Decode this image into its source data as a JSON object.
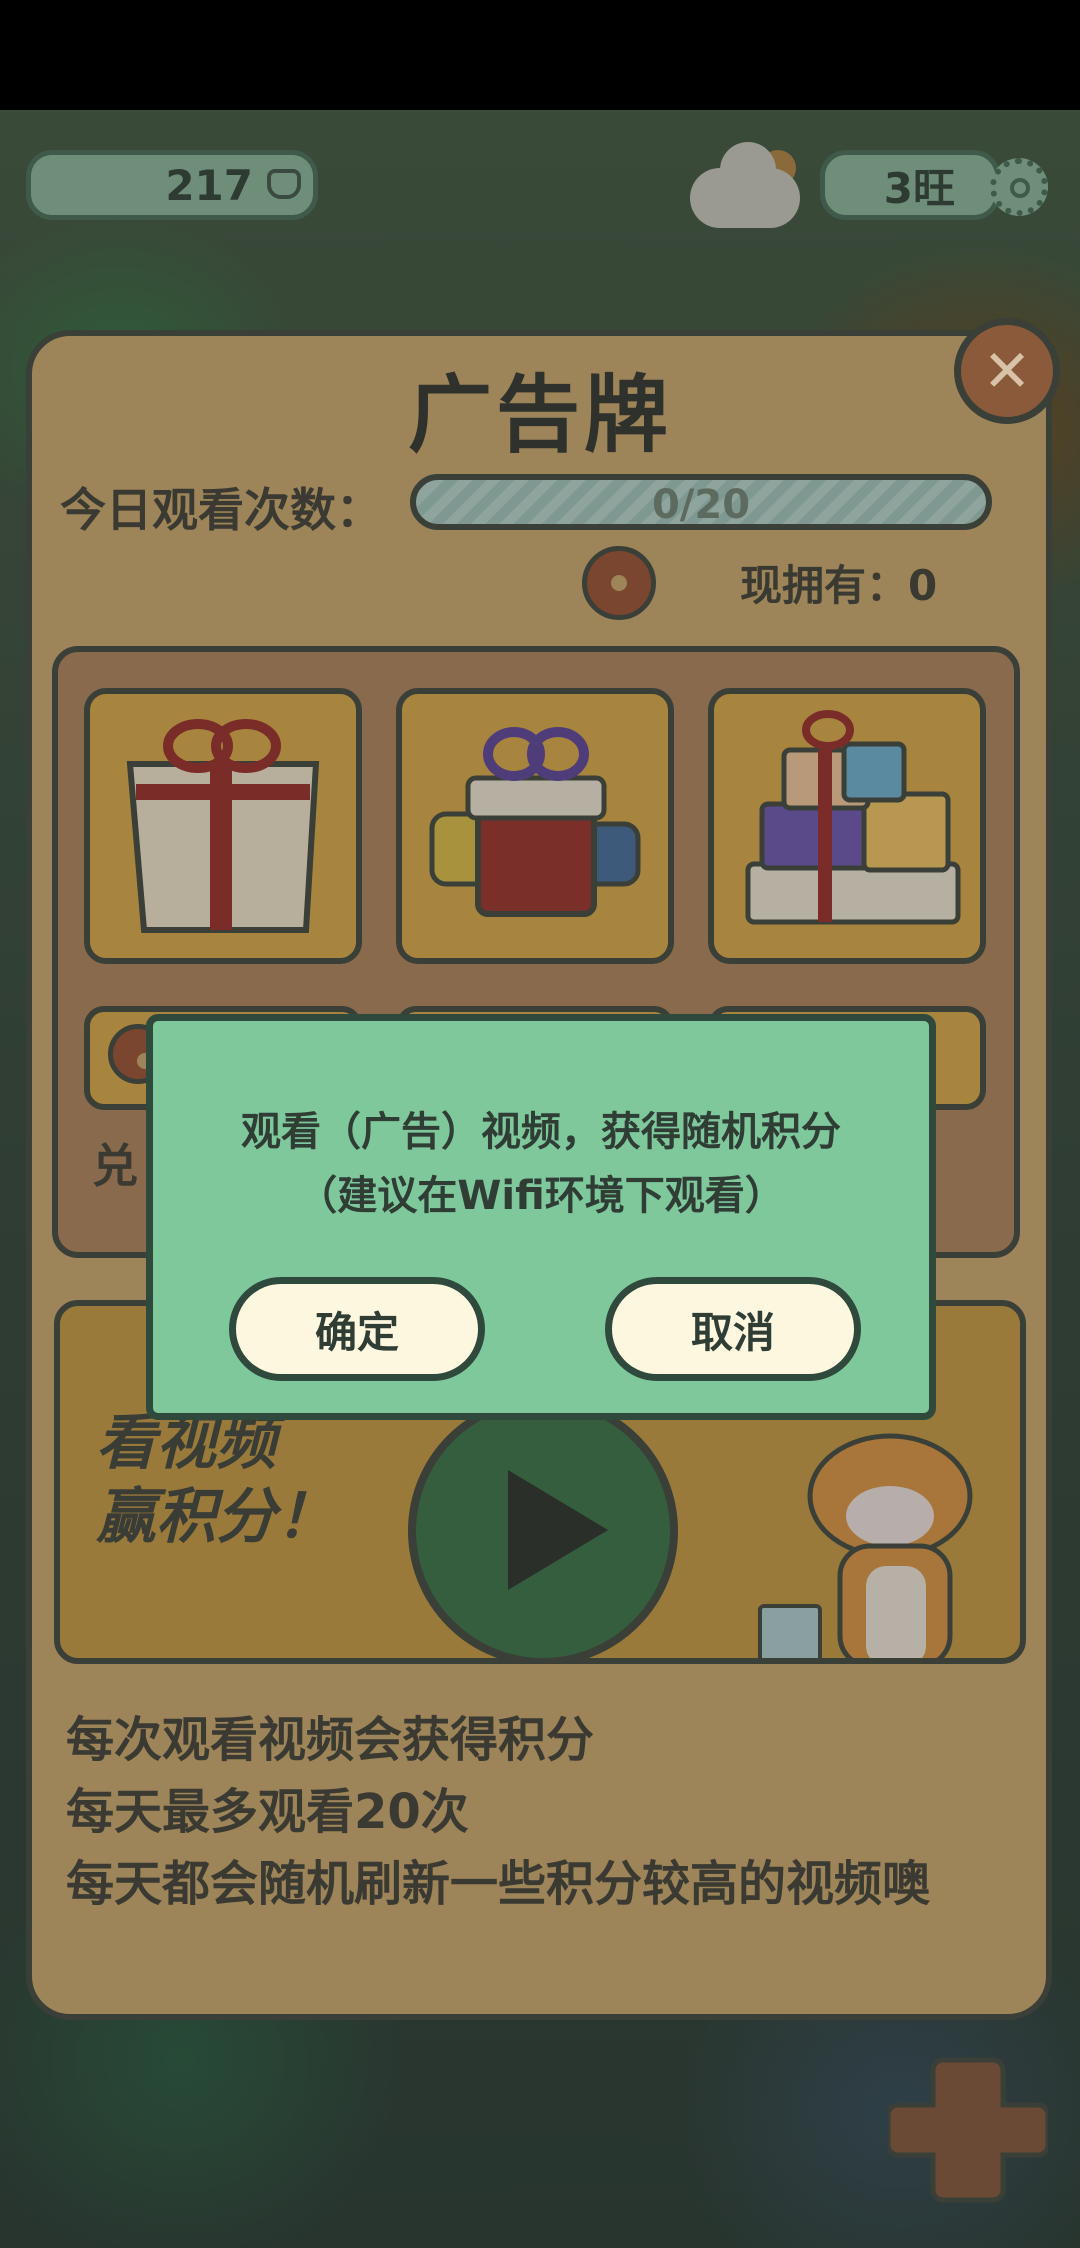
{
  "hud": {
    "score": "217",
    "wang": "3旺"
  },
  "panel": {
    "title": "广告牌",
    "watch_label": "今日观看次数：",
    "progress": {
      "text": "0/20",
      "fraction": 0
    },
    "owned": "现拥有：0",
    "redeem_label": "兑",
    "video_banner": {
      "line1": "看视频",
      "line2": "赢积分！"
    },
    "descriptions": [
      "每次观看视频会获得积分",
      "每天最多观看20次",
      "每天都会随机刷新一些积分较高的视频噢"
    ]
  },
  "dialog": {
    "message": "观看（广告）视频，获得随机积分",
    "note": "（建议在Wifi环境下观看）",
    "confirm": "确定",
    "cancel": "取消"
  },
  "colors": {
    "panel": "#9e8459",
    "dialog": "#7ec89c",
    "button": "#fdf7e0",
    "outline": "#3a3f38"
  }
}
